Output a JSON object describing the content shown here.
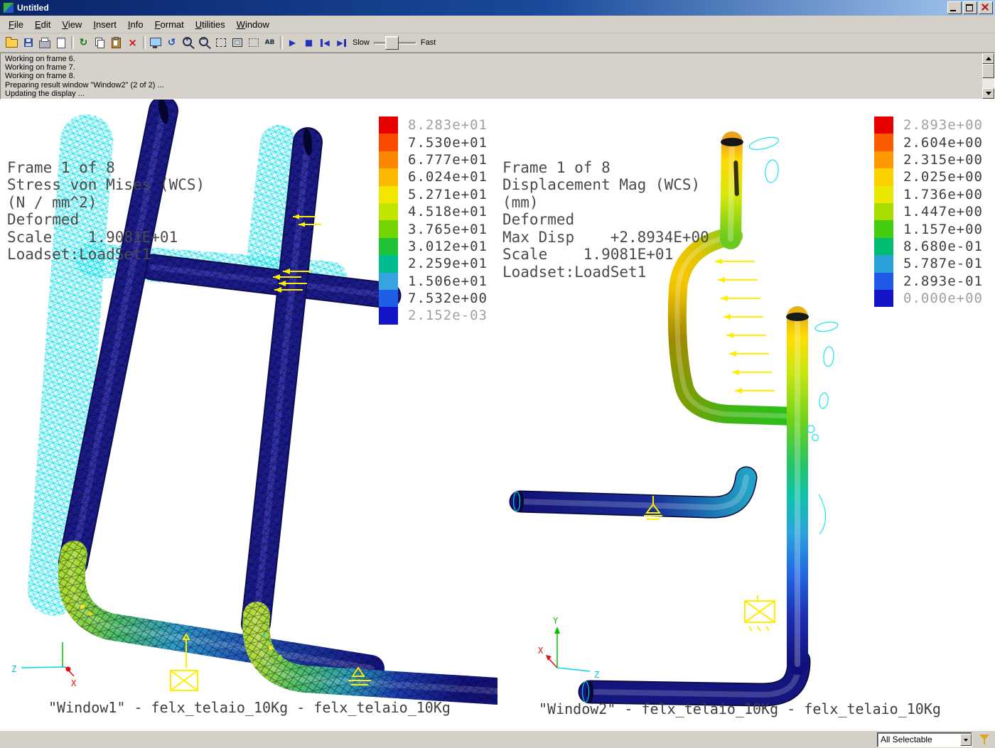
{
  "window": {
    "title": "Untitled"
  },
  "menu": {
    "items": [
      {
        "label": "File",
        "n": "menu-item-file"
      },
      {
        "label": "Edit",
        "n": "menu-item-edit"
      },
      {
        "label": "View",
        "n": "menu-item-view"
      },
      {
        "label": "Insert",
        "n": "menu-item-insert"
      },
      {
        "label": "Info",
        "n": "menu-item-info"
      },
      {
        "label": "Format",
        "n": "menu-item-format"
      },
      {
        "label": "Utilities",
        "n": "menu-item-utilities"
      },
      {
        "label": "Window",
        "n": "menu-item-window"
      }
    ]
  },
  "toolbar": {
    "slow": "Slow",
    "fast": "Fast",
    "icons": [
      {
        "button": "open-button",
        "icon": "open-icon",
        "cls": "ic-open",
        "glyph": "",
        "ia": "true"
      },
      {
        "button": "save-button",
        "icon": "save-icon",
        "cls": "ic-save",
        "glyph": "",
        "ia": "true"
      },
      {
        "button": "print-button",
        "icon": "printer-icon",
        "cls": "ic-print",
        "glyph": "",
        "ia": "true"
      },
      {
        "button": "print-preview-button",
        "icon": "page-icon",
        "cls": "ic-page",
        "glyph": "",
        "ia": "true"
      },
      {
        "button": "toolbar-separator",
        "icon": "separator",
        "cls": "tsep",
        "bcls": "tsep-wrap",
        "glyph": "",
        "ia": "false"
      },
      {
        "button": "regenerate-button",
        "icon": "regenerate-icon",
        "cls": "ic-regen",
        "glyph": "↻",
        "ia": "true"
      },
      {
        "button": "copy-button",
        "icon": "copy-icon",
        "cls": "ic-copy",
        "glyph": "",
        "ia": "true"
      },
      {
        "button": "paste-button",
        "icon": "paste-icon",
        "cls": "ic-paste",
        "glyph": "",
        "ia": "true"
      },
      {
        "button": "delete-button",
        "icon": "delete-x-icon",
        "cls": "ic-x",
        "glyph": "×",
        "ia": "true"
      },
      {
        "button": "toolbar-separator",
        "icon": "separator",
        "cls": "tsep",
        "bcls": "tsep-wrap",
        "glyph": "",
        "ia": "false"
      },
      {
        "button": "repaint-button",
        "icon": "monitor-icon",
        "cls": "ic-mon",
        "glyph": "",
        "ia": "true"
      },
      {
        "button": "spin-button",
        "icon": "spin-arrow-icon",
        "cls": "ic-spin",
        "glyph": "↺",
        "ia": "true"
      },
      {
        "button": "zoom-in-button",
        "icon": "zoom-in-icon",
        "cls": "ic-zin",
        "glyph": "",
        "ia": "true"
      },
      {
        "button": "zoom-out-button",
        "icon": "zoom-out-icon",
        "cls": "ic-zout",
        "glyph": "",
        "ia": "true"
      },
      {
        "button": "zoom-window-button",
        "icon": "zoom-window-icon",
        "cls": "ic-zwin",
        "glyph": "",
        "ia": "true"
      },
      {
        "button": "refit-button",
        "icon": "refit-icon",
        "cls": "ic-refit",
        "glyph": "",
        "ia": "true"
      },
      {
        "button": "select-box-button",
        "icon": "select-box-icon",
        "cls": "ic-sel",
        "glyph": "",
        "ia": "true"
      },
      {
        "button": "model-labels-button",
        "icon": "labels-ab-icon",
        "cls": "ic-ab",
        "glyph": "AB",
        "ia": "true"
      },
      {
        "button": "toolbar-separator",
        "icon": "separator",
        "cls": "tsep",
        "bcls": "tsep-wrap",
        "glyph": "",
        "ia": "false"
      },
      {
        "button": "play-button",
        "icon": "play-icon",
        "cls": "ic-play",
        "glyph": "▶",
        "ia": "true"
      },
      {
        "button": "stop-button",
        "icon": "stop-icon",
        "cls": "ic-stop",
        "glyph": "■",
        "ia": "true"
      },
      {
        "button": "step-back-button",
        "icon": "step-back-icon",
        "cls": "ic-stepb",
        "glyph": "◀",
        "ia": "true"
      },
      {
        "button": "step-forward-button",
        "icon": "step-forward-icon",
        "cls": "ic-stepf",
        "glyph": "▶",
        "ia": "true"
      }
    ]
  },
  "messages": {
    "lines": [
      "Working on frame 6.",
      "Working on frame 7.",
      "Working on frame 8.",
      "Preparing result window \"Window2\" (2 of 2) ...",
      "Updating the display ..."
    ]
  },
  "views": {
    "left": {
      "header": [
        "Frame 1 of 8",
        "Stress von Mises (WCS)",
        "(N / mm^2)",
        "Deformed",
        "Scale    1.9081E+01",
        "Loadset:LoadSet1"
      ],
      "legend": [
        {
          "v": "8.283e+01",
          "c": "#e80000",
          "dim": "dim"
        },
        {
          "v": "7.530e+01",
          "c": "#fa4a00"
        },
        {
          "v": "6.777e+01",
          "c": "#fd8600"
        },
        {
          "v": "6.024e+01",
          "c": "#fdb900"
        },
        {
          "v": "5.271e+01",
          "c": "#f2e500"
        },
        {
          "v": "4.518e+01",
          "c": "#bfe400"
        },
        {
          "v": "3.765e+01",
          "c": "#72d400"
        },
        {
          "v": "3.012e+01",
          "c": "#1ec337"
        },
        {
          "v": "2.259e+01",
          "c": "#00bd8f"
        },
        {
          "v": "1.506e+01",
          "c": "#35a3dd"
        },
        {
          "v": "7.532e+00",
          "c": "#1f5fe8"
        },
        {
          "v": "2.152e-03",
          "c": "#1414c8",
          "dim": "dim"
        }
      ],
      "caption": "\"Window1\" - felx_telaio_10Kg - felx_telaio_10Kg",
      "axes": {
        "x": "X",
        "z": "Z"
      }
    },
    "right": {
      "header": [
        "Frame 1 of 8",
        "Displacement Mag (WCS)",
        "(mm)",
        "Deformed",
        "Max Disp    +2.8934E+00",
        "Scale    1.9081E+01",
        "Loadset:LoadSet1"
      ],
      "legend": [
        {
          "v": "2.893e+00",
          "c": "#e80000",
          "dim": "dim"
        },
        {
          "v": "2.604e+00",
          "c": "#fa5a00"
        },
        {
          "v": "2.315e+00",
          "c": "#fd9800"
        },
        {
          "v": "2.025e+00",
          "c": "#fdd000"
        },
        {
          "v": "1.736e+00",
          "c": "#eae800"
        },
        {
          "v": "1.447e+00",
          "c": "#a8dc00"
        },
        {
          "v": "1.157e+00",
          "c": "#44cc10"
        },
        {
          "v": "8.680e-01",
          "c": "#00bd72"
        },
        {
          "v": "5.787e-01",
          "c": "#2aa0d8"
        },
        {
          "v": "2.893e-01",
          "c": "#1f5ae8"
        },
        {
          "v": "0.000e+00",
          "c": "#1414c8",
          "dim": "dim"
        }
      ],
      "caption": "\"Window2\" - felx_telaio_10Kg - felx_telaio_10Kg",
      "axes": {
        "x": "X",
        "y": "Y",
        "z": "Z"
      }
    }
  },
  "statusbar": {
    "selector": "All Selectable"
  }
}
